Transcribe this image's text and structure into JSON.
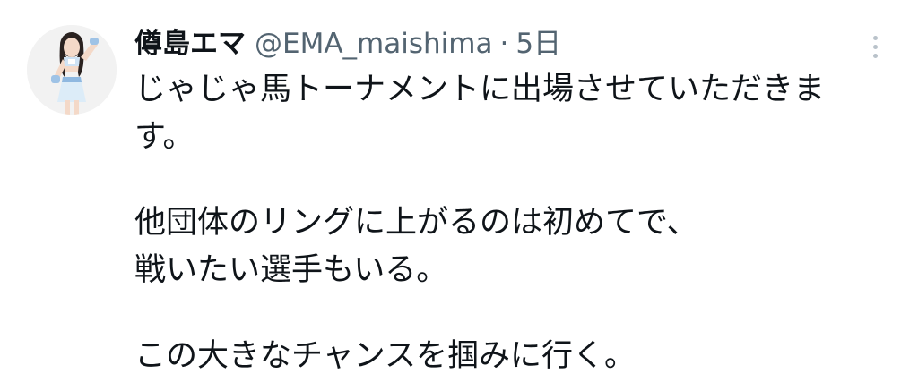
{
  "tweet": {
    "author": {
      "display_name": "僔島エマ",
      "handle": "@EMA_maishima",
      "avatar_icon": "profile-photo"
    },
    "separator": "·",
    "timestamp": "5日",
    "more_icon": "more-vertical-icon",
    "text_lines": [
      "じゃじゃ馬トーナメントに出場させていただきま",
      "す。",
      "",
      "他団体のリングに上がるのは初めてで、",
      "戦いたい選手もいる。",
      "",
      "この大きなチャンスを掴みに行く。"
    ]
  },
  "colors": {
    "text_primary": "#0f1419",
    "text_secondary": "#536471",
    "more_icon": "#b9c2ca",
    "background": "#ffffff"
  }
}
